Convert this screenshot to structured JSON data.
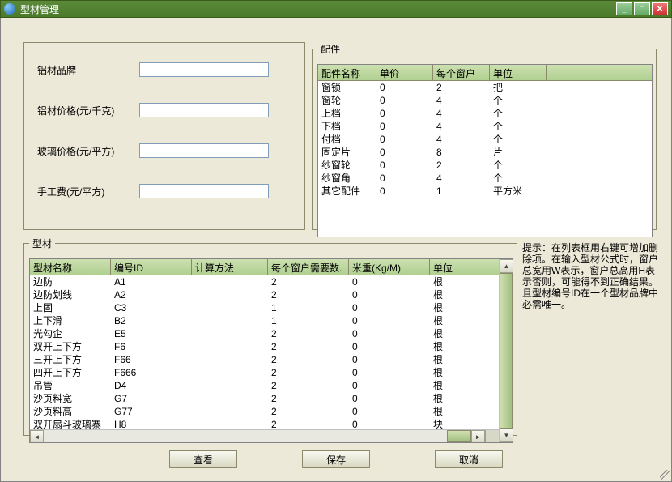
{
  "window": {
    "title": "型材管理"
  },
  "form": {
    "brand_label": "铝材品牌",
    "brand_value": "",
    "alu_price_label": "铝材价格(元/千克)",
    "alu_price_value": "",
    "glass_price_label": "玻璃价格(元/平方)",
    "glass_price_value": "",
    "labor_label": "手工费(元/平方)",
    "labor_value": ""
  },
  "parts": {
    "legend": "配件",
    "columns": [
      "配件名称",
      "单价",
      "每个窗户",
      "单位"
    ],
    "rows": [
      {
        "name": "窗锁",
        "price": "0",
        "per": "2",
        "unit": "把"
      },
      {
        "name": "窗轮",
        "price": "0",
        "per": "4",
        "unit": "个"
      },
      {
        "name": "上档",
        "price": "0",
        "per": "4",
        "unit": "个"
      },
      {
        "name": "下档",
        "price": "0",
        "per": "4",
        "unit": "个"
      },
      {
        "name": "付档",
        "price": "0",
        "per": "4",
        "unit": "个"
      },
      {
        "name": "固定片",
        "price": "0",
        "per": "8",
        "unit": "片"
      },
      {
        "name": "纱窗轮",
        "price": "0",
        "per": "2",
        "unit": "个"
      },
      {
        "name": "纱窗角",
        "price": "0",
        "per": "4",
        "unit": "个"
      },
      {
        "name": "其它配件",
        "price": "0",
        "per": "1",
        "unit": "平方米"
      }
    ]
  },
  "profiles": {
    "legend": "型材",
    "columns": [
      "型材名称",
      "编号ID",
      "计算方法",
      "每个窗户需要数.",
      "米重(Kg/M)",
      "单位"
    ],
    "rows": [
      {
        "name": "边防",
        "id": "A1",
        "calc": "",
        "per": "2",
        "w": "0",
        "unit": "根"
      },
      {
        "name": "边防划线",
        "id": "A2",
        "calc": "",
        "per": "2",
        "w": "0",
        "unit": "根"
      },
      {
        "name": "上固",
        "id": "C3",
        "calc": "",
        "per": "1",
        "w": "0",
        "unit": "根"
      },
      {
        "name": "上下滑",
        "id": "B2",
        "calc": "",
        "per": "1",
        "w": "0",
        "unit": "根"
      },
      {
        "name": "光勾企",
        "id": "E5",
        "calc": "",
        "per": "2",
        "w": "0",
        "unit": "根"
      },
      {
        "name": "双开上下方",
        "id": "F6",
        "calc": "",
        "per": "2",
        "w": "0",
        "unit": "根"
      },
      {
        "name": "三开上下方",
        "id": "F66",
        "calc": "",
        "per": "2",
        "w": "0",
        "unit": "根"
      },
      {
        "name": "四开上下方",
        "id": "F666",
        "calc": "",
        "per": "2",
        "w": "0",
        "unit": "根"
      },
      {
        "name": "吊管",
        "id": "D4",
        "calc": "",
        "per": "2",
        "w": "0",
        "unit": "根"
      },
      {
        "name": "沙页料宽",
        "id": "G7",
        "calc": "",
        "per": "2",
        "w": "0",
        "unit": "根"
      },
      {
        "name": "沙页料高",
        "id": "G77",
        "calc": "",
        "per": "2",
        "w": "0",
        "unit": "根"
      },
      {
        "name": "双开扇斗玻璃寨",
        "id": "H8",
        "calc": "",
        "per": "2",
        "w": "0",
        "unit": "块"
      }
    ]
  },
  "hint": "提示：在列表框用右键可增加删除项。在输入型材公式时，窗户总宽用W表示，窗户总高用H表示否则，可能得不到正确结果。且型材编号ID在一个型材品牌中必需唯一。",
  "buttons": {
    "view": "查看",
    "save": "保存",
    "cancel": "取消"
  }
}
